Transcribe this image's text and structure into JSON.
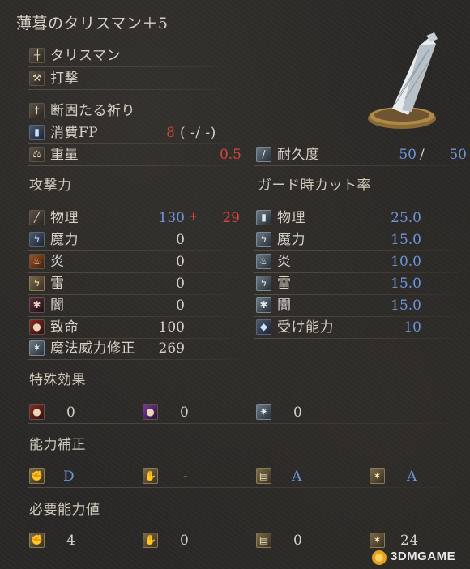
{
  "title": "薄暮のタリスマン＋5",
  "type_label": "タリスマン",
  "attack_type": "打撃",
  "skill": "断固たる祈り",
  "fp": {
    "label": "消費FP",
    "cost": "8",
    "paren": "(   -/   -)"
  },
  "weight": {
    "label": "重量",
    "value": "0.5"
  },
  "durability": {
    "label": "耐久度",
    "current": "50",
    "sep": "/",
    "max": "50"
  },
  "attack": {
    "heading": "攻撃力",
    "physical": {
      "label": "物理",
      "value": "130",
      "plus": "+",
      "bonus": "29"
    },
    "magic": {
      "label": "魔力",
      "value": "0"
    },
    "fire": {
      "label": "炎",
      "value": "0"
    },
    "lightning": {
      "label": "雷",
      "value": "0"
    },
    "dark": {
      "label": "闇",
      "value": "0"
    },
    "critical": {
      "label": "致命",
      "value": "100"
    },
    "spell_buff": {
      "label": "魔法威力修正",
      "value": "269"
    }
  },
  "guard": {
    "heading": "ガード時カット率",
    "physical": {
      "label": "物理",
      "value": "25.0"
    },
    "magic": {
      "label": "魔力",
      "value": "15.0"
    },
    "fire": {
      "label": "炎",
      "value": "10.0"
    },
    "lightning": {
      "label": "雷",
      "value": "15.0"
    },
    "dark": {
      "label": "闇",
      "value": "15.0"
    },
    "stability": {
      "label": "受け能力",
      "value": "10"
    }
  },
  "effects": {
    "heading": "特殊効果",
    "values": [
      "0",
      "0",
      "0"
    ]
  },
  "scaling": {
    "heading": "能力補正",
    "values": [
      "D",
      "-",
      "A",
      "A"
    ]
  },
  "requirements": {
    "heading": "必要能力値",
    "values": [
      "4",
      "0",
      "0",
      "24"
    ]
  },
  "watermark": "3DMGAME",
  "colors": {
    "blue": "#6e95d8",
    "red": "#d8443a",
    "text": "#d8d2c6"
  }
}
